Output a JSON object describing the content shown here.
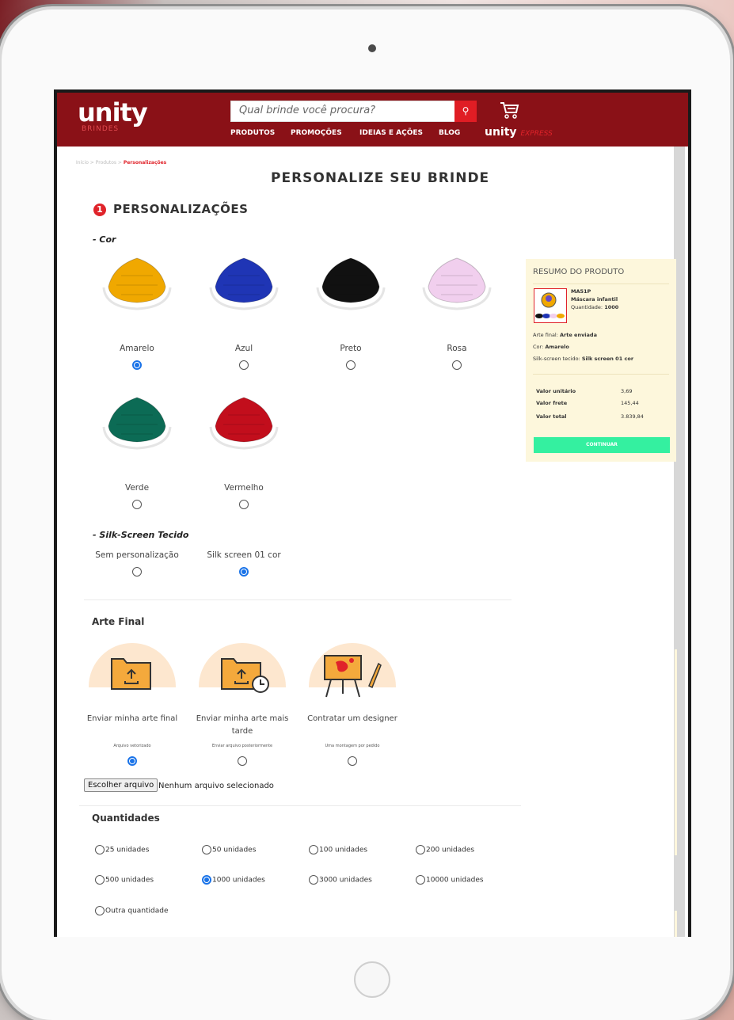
{
  "header": {
    "logo": "unity",
    "logo_sub": "BRINDES",
    "search_placeholder": "Qual brinde você procura?",
    "nav": [
      "PRODUTOS",
      "PROMOÇÕES",
      "IDEIAS E AÇÕES",
      "BLOG"
    ],
    "express_brand": "unity",
    "express_label": "EXPRESS"
  },
  "breadcrumb": {
    "path": "Início > Produtos > ",
    "current": "Personalizações"
  },
  "page_title": "PERSONALIZE SEU BRINDE",
  "section": {
    "number": "1",
    "title": "PERSONALIZAÇÕES"
  },
  "cor": {
    "title": "- Cor",
    "options": [
      {
        "label": "Amarelo",
        "color": "#f0a800",
        "selected": true
      },
      {
        "label": "Azul",
        "color": "#1f35b5",
        "selected": false
      },
      {
        "label": "Preto",
        "color": "#111111",
        "selected": false
      },
      {
        "label": "Rosa",
        "color": "#f1cfee",
        "selected": false
      },
      {
        "label": "Verde",
        "color": "#0c6b55",
        "selected": false
      },
      {
        "label": "Vermelho",
        "color": "#c20e1c",
        "selected": false
      }
    ]
  },
  "silk": {
    "title": "- Silk-Screen Tecido",
    "options": [
      {
        "label": "Sem personalização",
        "selected": false
      },
      {
        "label": "Silk screen 01 cor",
        "selected": true
      }
    ]
  },
  "arte": {
    "title": "Arte Final",
    "options": [
      {
        "label": "Enviar minha arte final",
        "hint": "Arquivo vetorizado",
        "selected": true
      },
      {
        "label": "Enviar minha arte mais tarde",
        "hint": "Enviar arquivo posteriormente",
        "selected": false
      },
      {
        "label": "Contratar um designer",
        "hint": "Uma montagem por pedido",
        "selected": false
      }
    ],
    "file_button": "Escolher arquivo",
    "file_status": "Nenhum arquivo selecionado"
  },
  "quantidades": {
    "title": "Quantidades",
    "options": [
      {
        "label": "25 unidades",
        "selected": false
      },
      {
        "label": "50 unidades",
        "selected": false
      },
      {
        "label": "100 unidades",
        "selected": false
      },
      {
        "label": "200 unidades",
        "selected": false
      },
      {
        "label": "500 unidades",
        "selected": false
      },
      {
        "label": "1000 unidades",
        "selected": true
      },
      {
        "label": "3000 unidades",
        "selected": false
      },
      {
        "label": "10000 unidades",
        "selected": false
      },
      {
        "label": "Outra quantidade",
        "selected": false
      }
    ]
  },
  "summary": {
    "title": "RESUMO DO PRODUTO",
    "code": "MA51P",
    "name": "Máscara infantil",
    "qty_label": "Quantidade:",
    "qty_value": "1000",
    "arte_label": "Arte final:",
    "arte_value": "Arte enviada",
    "cor_label": "Cor:",
    "cor_value": "Amarelo",
    "silk_label": "Silk-screen tecido:",
    "silk_value": "Silk screen 01 cor",
    "unit_label": "Valor unitário",
    "unit_value": "3,69",
    "frete_label": "Valor frete",
    "frete_value": "145,44",
    "total_label": "Valor total",
    "total_value": "3.839,84",
    "button": "CONTINUAR"
  },
  "colors": {
    "brand_red": "#8a1117",
    "accent_red": "#e0232a",
    "continue_green": "#34f0a0",
    "summary_bg": "#fdf7dc"
  }
}
